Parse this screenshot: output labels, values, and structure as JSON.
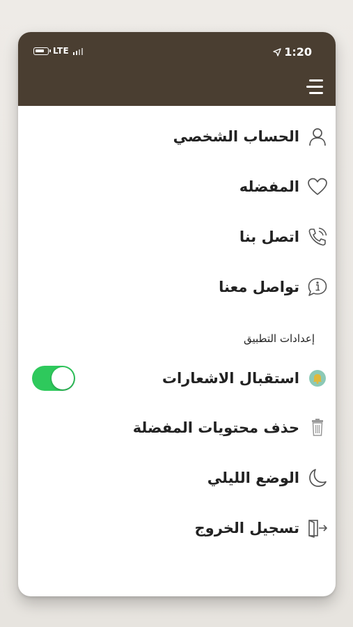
{
  "status_bar": {
    "network": "LTE",
    "time": "1:20"
  },
  "menu": {
    "items": [
      {
        "label": "الحساب الشخصي",
        "icon": "user-icon"
      },
      {
        "label": "المفضله",
        "icon": "heart-icon"
      },
      {
        "label": "اتصل بنا",
        "icon": "phone-icon"
      },
      {
        "label": "تواصل معنا",
        "icon": "info-bubble-icon"
      }
    ]
  },
  "settings": {
    "title": "إعدادات التطبيق",
    "items": [
      {
        "label": "استقبال  الاشعارات",
        "icon": "bell-icon",
        "toggle": true
      },
      {
        "label": "حذف محتويات المفضلة",
        "icon": "trash-icon"
      },
      {
        "label": "الوضع الليلي",
        "icon": "moon-icon"
      },
      {
        "label": "تسجيل الخروج",
        "icon": "logout-icon"
      }
    ]
  },
  "colors": {
    "header": "#4a3e31",
    "toggle_on": "#2ec95c",
    "bell": "#e0b83a",
    "bell_bg": "#8cc9b6"
  }
}
